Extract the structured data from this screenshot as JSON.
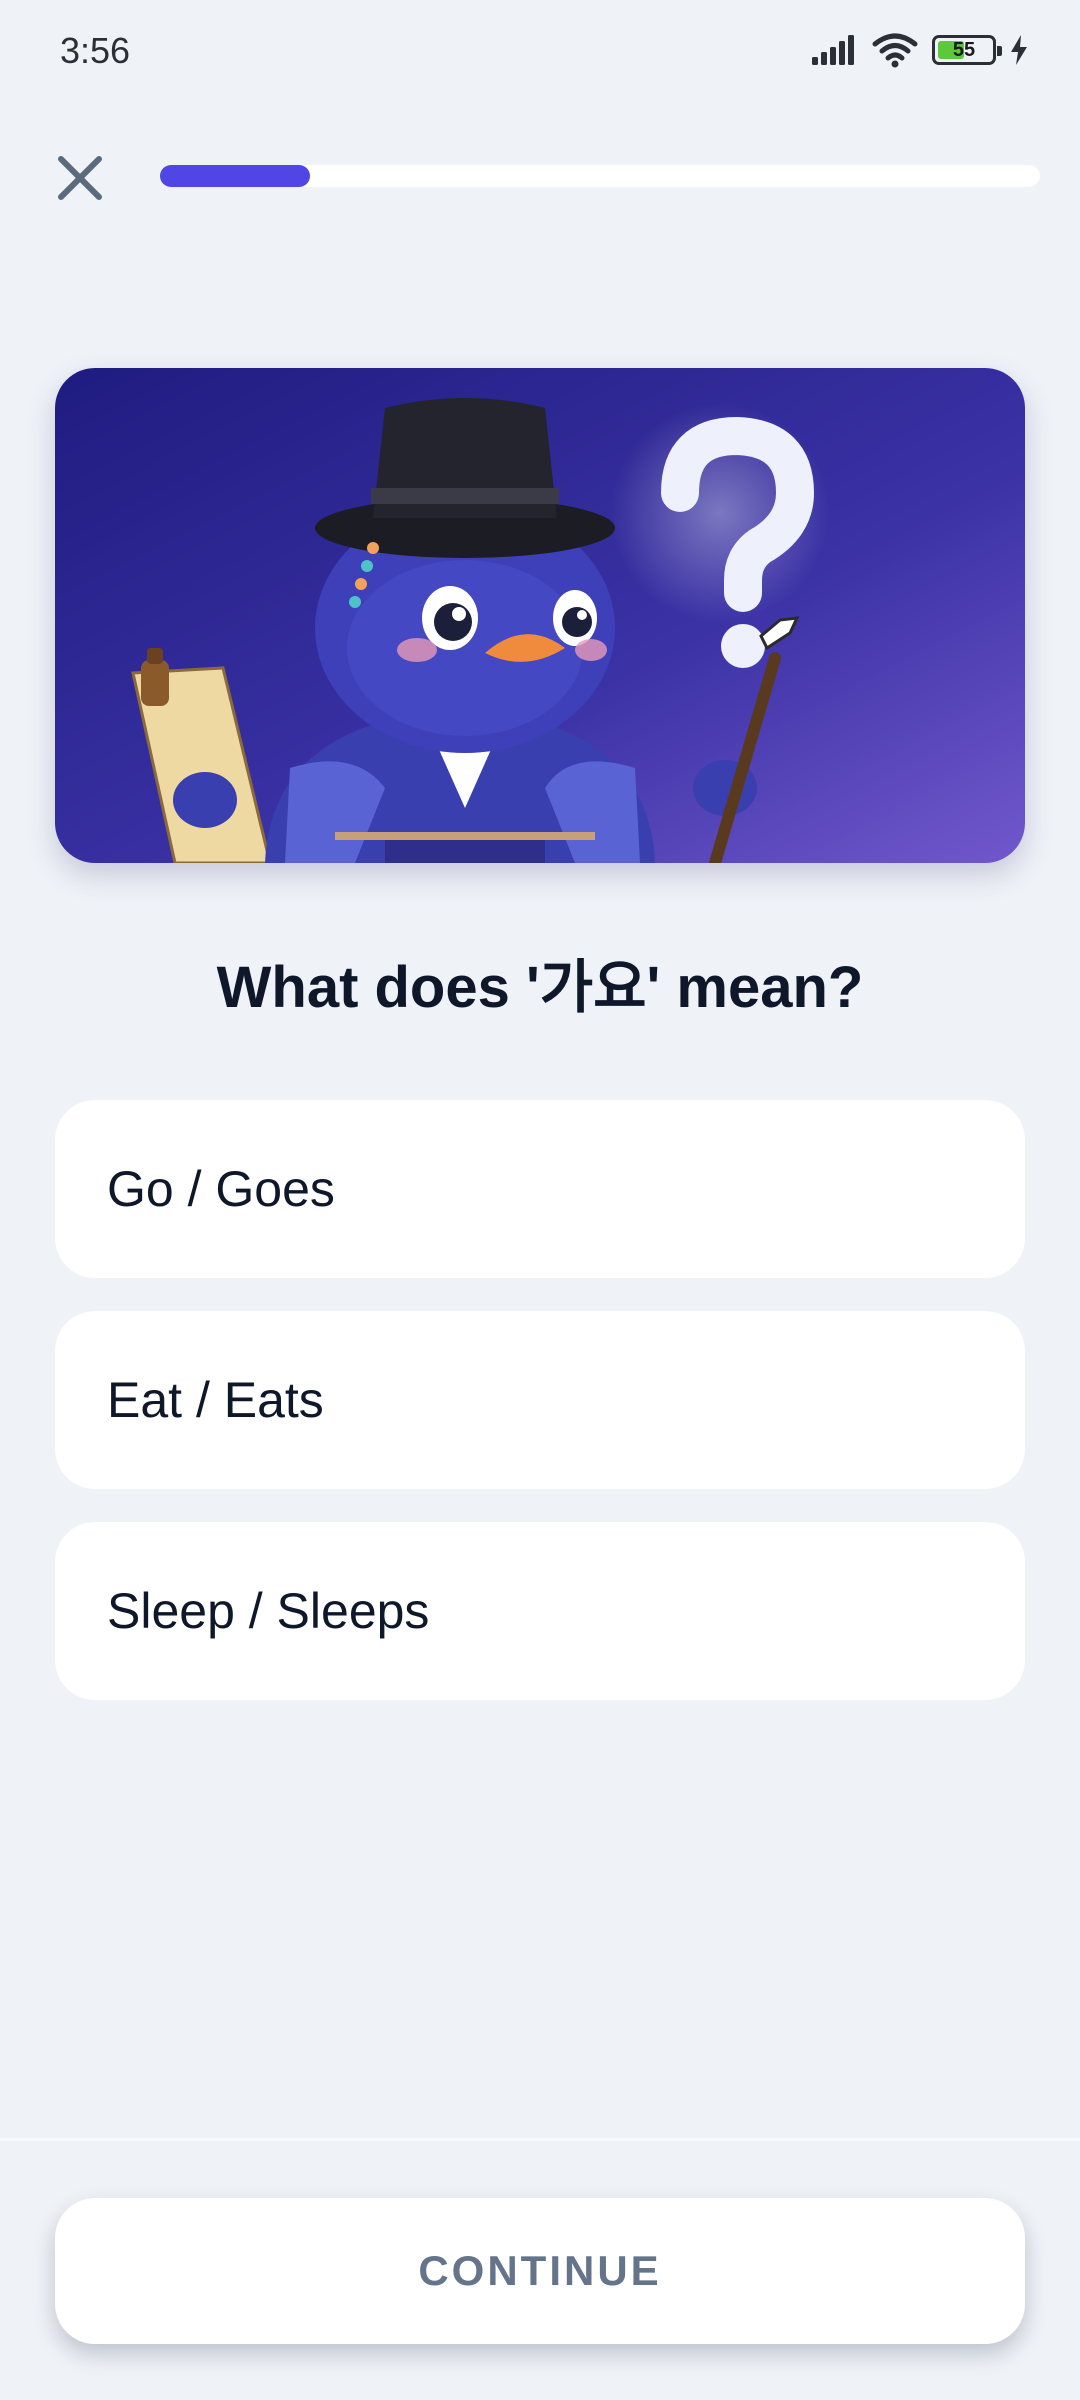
{
  "status_bar": {
    "time": "3:56",
    "battery_level": "55",
    "battery_fraction": 0.55,
    "icons": [
      "signal-icon",
      "wifi-icon",
      "battery-icon",
      "charging-icon"
    ],
    "battery_color": "#5cc83a"
  },
  "quiz": {
    "progress_fraction": 0.17,
    "accent_color": "#4f46e5",
    "close_icon": "close-icon",
    "question": "What does '가요' mean?",
    "options": [
      {
        "label": "Go / Goes"
      },
      {
        "label": "Eat / Eats"
      },
      {
        "label": "Sleep / Sleeps"
      }
    ],
    "continue_label": "CONTINUE"
  },
  "hero": {
    "illustration": "blue bird in hanbok and gat hat holding a scroll and brush, with a question mark",
    "gradient_colors": [
      "#221f86",
      "#6b55c6"
    ]
  }
}
